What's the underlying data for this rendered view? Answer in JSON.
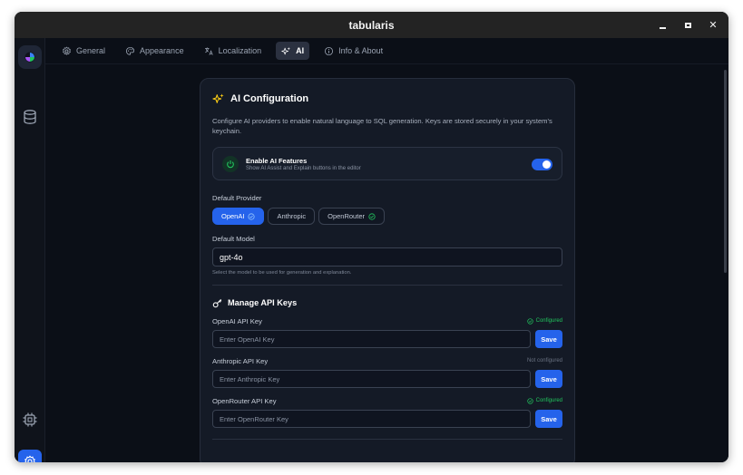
{
  "window": {
    "title": "tabularis"
  },
  "tabs": [
    {
      "label": "General",
      "icon": "gear-icon"
    },
    {
      "label": "Appearance",
      "icon": "palette-icon"
    },
    {
      "label": "Localization",
      "icon": "translate-icon"
    },
    {
      "label": "AI",
      "icon": "sparkles-icon",
      "active": true
    },
    {
      "label": "Info & About",
      "icon": "info-icon"
    }
  ],
  "ai": {
    "title": "AI Configuration",
    "description": "Configure AI providers to enable natural language to SQL generation. Keys are stored securely in your system's keychain.",
    "enable": {
      "title": "Enable AI Features",
      "subtitle": "Show AI Assist and Explain buttons in the editor",
      "enabled": true
    },
    "provider": {
      "label": "Default Provider",
      "options": [
        "OpenAI",
        "Anthropic",
        "OpenRouter"
      ],
      "selected": "OpenAI"
    },
    "model": {
      "label": "Default Model",
      "value": "gpt-4o",
      "hint": "Select the model to be used for generation and explanation."
    },
    "keys": {
      "title": "Manage API Keys",
      "save_label": "Save",
      "items": [
        {
          "label": "OpenAI API Key",
          "status": "Configured",
          "placeholder": "Enter OpenAI Key"
        },
        {
          "label": "Anthropic API Key",
          "status": "Not configured",
          "placeholder": "Enter Anthropic Key"
        },
        {
          "label": "OpenRouter API Key",
          "status": "Configured",
          "placeholder": "Enter OpenRouter Key"
        }
      ]
    }
  },
  "colors": {
    "accent": "#2563eb",
    "success": "#22c55e",
    "background": "#0b0f17",
    "card": "#141a26"
  }
}
